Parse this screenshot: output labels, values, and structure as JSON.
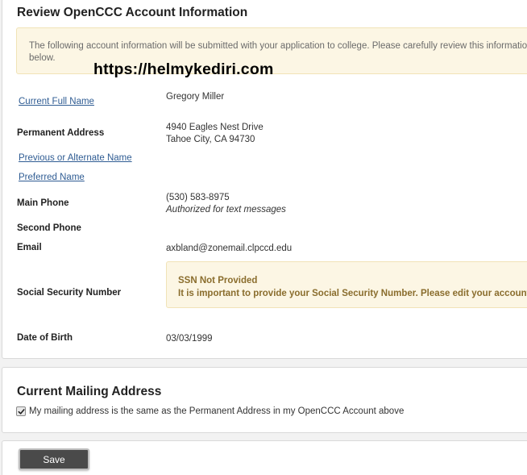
{
  "review": {
    "title": "Review OpenCCC Account Information",
    "notice_line1": "The following account information will be submitted with your application to college. Please carefully review this information",
    "notice_line2": "below."
  },
  "watermark": "https://helmykediri.com",
  "fields": {
    "current_full_name": {
      "label": "Current Full Name",
      "value": "Gregory Miller"
    },
    "permanent_address": {
      "label": "Permanent Address",
      "line1": "4940 Eagles Nest Drive",
      "line2": "Tahoe City, CA 94730"
    },
    "previous_name": {
      "label": "Previous or Alternate Name"
    },
    "preferred_name": {
      "label": "Preferred Name"
    },
    "main_phone": {
      "label": "Main Phone",
      "value": "(530) 583-8975",
      "note": "Authorized for text messages"
    },
    "second_phone": {
      "label": "Second Phone"
    },
    "email": {
      "label": "Email",
      "value": "axbland@zonemail.clpccd.edu"
    },
    "ssn": {
      "label": "Social Security Number",
      "status": "SSN Not Provided",
      "message": "It is important to provide your Social Security Number. Please edit your account."
    },
    "dob": {
      "label": "Date of Birth",
      "value": "03/03/1999"
    }
  },
  "mailing": {
    "title": "Current Mailing Address",
    "same_as_permanent_label": "My mailing address is the same as the Permanent Address in my OpenCCC Account above",
    "same_as_permanent_checked": true
  },
  "actions": {
    "save_label": "Save"
  },
  "colors": {
    "link": "#2f5c93",
    "notice_bg": "#fcf6e4",
    "notice_border": "#f1e3b7",
    "warning_text": "#8a6d2d",
    "button_bg": "#4a4a4a"
  }
}
